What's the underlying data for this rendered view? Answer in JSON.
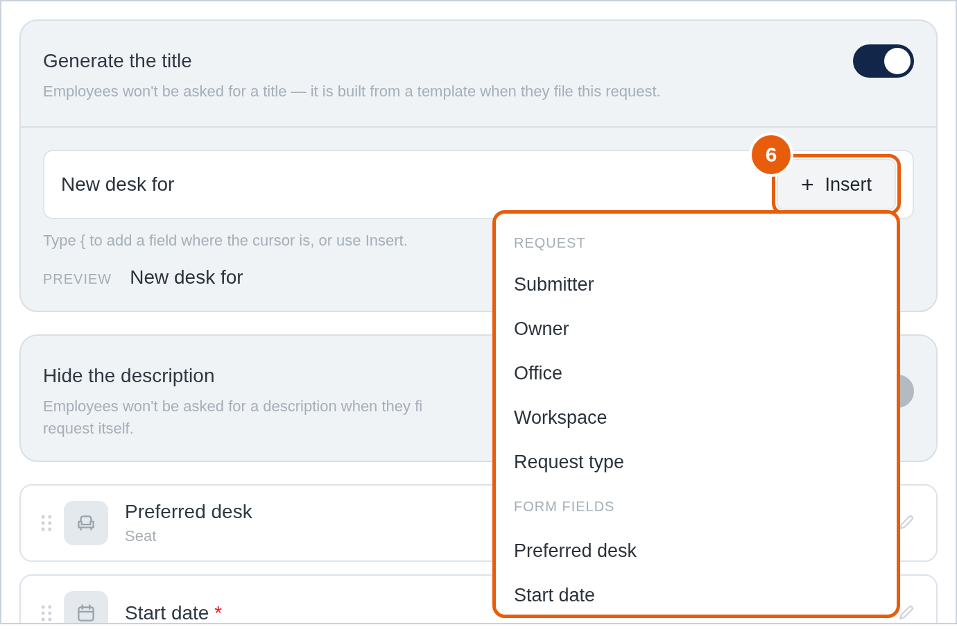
{
  "title_card": {
    "title": "Generate the title",
    "description": "Employees won't be asked for a title — it is built from a template when they file this request.",
    "on": true,
    "template_field": {
      "value": "New desk for"
    },
    "insert_button": {
      "label": "Insert",
      "icon": "+",
      "highlighted": true,
      "step_badge": "6"
    },
    "hint": "Type { to add a field where the cursor is, or use Insert.",
    "preview_label": "PREVIEW",
    "preview_value": "New desk for"
  },
  "description_card": {
    "title": "Hide the description",
    "description_lines": [
      "Employees won't be asked for a description when they fi",
      "request itself."
    ],
    "on": false
  },
  "fields": [
    {
      "kind": "seat",
      "title": "Preferred desk",
      "subtitle": "Seat"
    },
    {
      "kind": "date",
      "title": "Start date",
      "required": true,
      "required_mark": "*"
    }
  ],
  "insert_menu": {
    "sections": [
      {
        "label": "REQUEST",
        "items": [
          "Submitter",
          "Owner",
          "Office",
          "Workspace",
          "Request type"
        ]
      },
      {
        "label": "FORM FIELDS",
        "items": [
          "Preferred desk",
          "Start date"
        ]
      }
    ]
  }
}
